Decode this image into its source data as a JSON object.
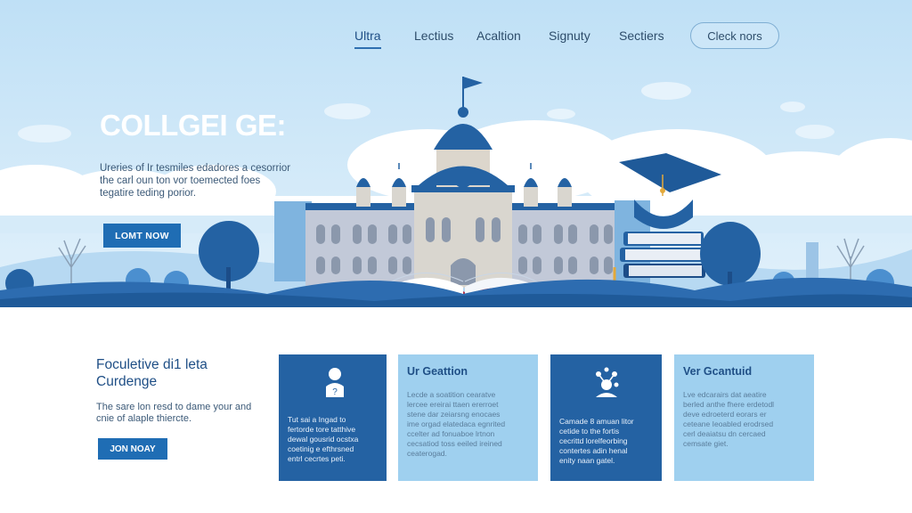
{
  "nav": {
    "links": [
      "Ultra",
      "Lectius",
      "Acaltion",
      "Signuty",
      "Sectiers"
    ],
    "cta": "Cleck nors"
  },
  "hero": {
    "title": "COLLGEI GE:",
    "description_lines": [
      "Ureries of Ir tesmiles edadores a cesorrior",
      "the carl oun ton vor toemected foes",
      "tegatire teding porior."
    ],
    "button": "LOMT NOW"
  },
  "section": {
    "title_lines": [
      "Foculetive di1 leta",
      "Curdenge"
    ],
    "description_lines": [
      "The sare lon resd to dame your and",
      "cnie of alaple thiercte."
    ],
    "button": "JON NOAY"
  },
  "cards": [
    {
      "style": "dark",
      "icon": "person-icon",
      "title": "",
      "body_lines": [
        "Tut sai a Ingad to",
        "fertorde tore tatthive",
        "dewal gousrid ocstxa",
        "coetinig e efthrsned",
        "entrl cecrtes peti."
      ]
    },
    {
      "style": "light",
      "icon": "",
      "title": "Ur Geattion",
      "body_lines": [
        "Lecde a soatition cearatve",
        "lercee ereirai ttaen ererroet",
        "stene dar zeiarsng enocaes",
        "ime orgad elatedaca egnrited",
        "ccelter ad fonuaboe lrtnon",
        "cecsatiod toss eeiled ireined",
        "ceaterogad."
      ]
    },
    {
      "style": "dark",
      "icon": "atom-icon",
      "title": "",
      "body_lines": [
        "Camade 8 amuan litor",
        "cetide to the fortis",
        "cecrittd lorelfeorbing",
        "contertes adin henal",
        "enity naan gatel."
      ]
    },
    {
      "style": "light",
      "icon": "",
      "title": "Ver Gcantuid",
      "body_lines": [
        "Lve edcarairs dat aeatire",
        "berled anthe fhere erdetodl",
        "deve edroeterd eorars er",
        "ceteane Ieoabled erodrsed",
        "cerl deaiatsu dn cercaed",
        "cemsate giet."
      ]
    }
  ],
  "colors": {
    "sky": "#cfe6f6",
    "primary": "#1f6db4",
    "dark_card": "#2462a3",
    "light_card": "#9fd0ef",
    "heading": "#1f4f86"
  }
}
